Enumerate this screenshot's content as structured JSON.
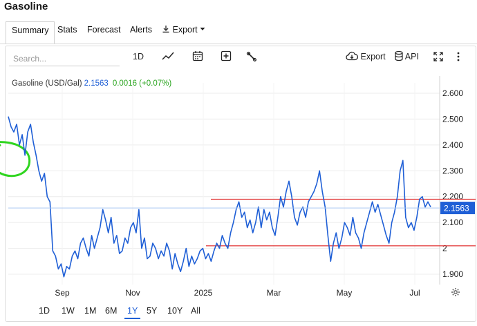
{
  "page": {
    "title": "Gasoline"
  },
  "tabs": [
    {
      "label": "Summary",
      "active": true
    },
    {
      "label": "Stats"
    },
    {
      "label": "Forecast"
    },
    {
      "label": "Alerts"
    },
    {
      "label": "Export",
      "icon": "download-icon",
      "dropdown": true
    }
  ],
  "toolbar": {
    "search_placeholder": "Search...",
    "interval_label": "1D",
    "export_label": "Export",
    "api_label": "API"
  },
  "legend": {
    "name": "Gasoline (USD/Gal)",
    "price": "2.1563",
    "change": "0.0016 (+0.07%)"
  },
  "ranges": [
    "1D",
    "1W",
    "1M",
    "6M",
    "1Y",
    "5Y",
    "10Y",
    "All"
  ],
  "active_range": "1Y",
  "colors": {
    "line": "#1f5fd6",
    "up": "#2aa51f",
    "annotation_lines": "#e03030",
    "circle": "#2fd51f",
    "price_line": "#a9c6f2"
  },
  "chart_data": {
    "type": "line",
    "title": "Gasoline (USD/Gal)",
    "x_tick_labels": [
      "Sep",
      "Nov",
      "2025",
      "Mar",
      "May",
      "Jul"
    ],
    "y_tick_labels": [
      "1.900",
      "2",
      "2.100",
      "2.200",
      "2.300",
      "2.400",
      "2.500",
      "2.600"
    ],
    "ylim": [
      1.86,
      2.64
    ],
    "last_price_label": "2.1563",
    "series": [
      {
        "values": [
          2.51,
          2.47,
          2.45,
          2.48,
          2.4,
          2.44,
          2.36,
          2.45,
          2.48,
          2.41,
          2.36,
          2.3,
          2.26,
          2.29,
          2.2,
          2.18,
          1.99,
          1.97,
          1.92,
          1.94,
          1.89,
          1.93,
          1.92,
          1.97,
          1.99,
          1.96,
          2.02,
          2.04,
          2.0,
          1.97,
          2.05,
          2.0,
          2.04,
          2.08,
          2.15,
          2.11,
          2.06,
          2.12,
          2.02,
          2.05,
          1.98,
          1.99,
          2.04,
          2.02,
          2.08,
          2.1,
          2.06,
          2.15,
          2.0,
          2.04,
          1.96,
          1.97,
          2.02,
          2.0,
          1.96,
          1.99,
          1.97,
          2.02,
          1.99,
          1.92,
          1.98,
          1.94,
          1.91,
          1.95,
          2.0,
          1.93,
          1.97,
          1.94,
          1.96,
          1.99,
          2.0,
          1.96,
          1.98,
          1.95,
          1.99,
          2.02,
          2.0,
          2.05,
          2.02,
          2.0,
          2.06,
          2.1,
          2.15,
          2.18,
          2.12,
          2.14,
          2.08,
          2.11,
          2.06,
          2.1,
          2.16,
          2.08,
          2.15,
          2.11,
          2.14,
          2.08,
          2.05,
          2.12,
          2.2,
          2.16,
          2.22,
          2.26,
          2.2,
          2.12,
          2.09,
          2.14,
          2.16,
          2.12,
          2.18,
          2.2,
          2.22,
          2.25,
          2.3,
          2.22,
          2.16,
          2.05,
          1.95,
          2.02,
          2.06,
          2.0,
          2.04,
          2.1,
          2.08,
          2.05,
          2.12,
          2.06,
          2.04,
          2.0,
          2.06,
          2.1,
          2.14,
          2.18,
          2.14,
          2.17,
          2.13,
          2.09,
          2.05,
          2.02,
          2.1,
          2.14,
          2.2,
          2.3,
          2.34,
          2.12,
          2.08,
          2.1,
          2.07,
          2.12,
          2.19,
          2.2,
          2.16,
          2.18,
          2.16
        ]
      }
    ],
    "annotations": {
      "horizontal_lines": [
        2.19,
        2.01
      ],
      "circled_peak": {
        "value": 2.34
      }
    }
  }
}
